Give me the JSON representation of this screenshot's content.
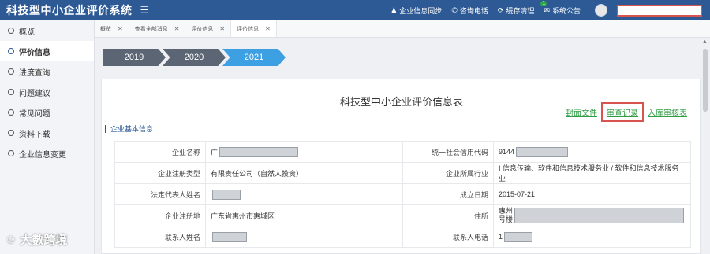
{
  "app": {
    "title": "科技型中小企业评价系统",
    "menu_icon": "hamburger-icon"
  },
  "topbar": {
    "actions": [
      {
        "icon": "user-icon",
        "label": "企业信息同步"
      },
      {
        "icon": "phone-icon",
        "label": "咨询电话"
      },
      {
        "icon": "cache-icon",
        "label": "缓存清理"
      },
      {
        "icon": "notice-icon",
        "label": "系统公告",
        "badge": "1"
      }
    ]
  },
  "sidebar": {
    "items": [
      {
        "label": "概览"
      },
      {
        "label": "评价信息"
      },
      {
        "label": "进度查询"
      },
      {
        "label": "问题建议"
      },
      {
        "label": "常见问题"
      },
      {
        "label": "资料下载"
      },
      {
        "label": "企业信息变更"
      }
    ]
  },
  "tabs": [
    {
      "label": "概览"
    },
    {
      "label": "查看全部消息"
    },
    {
      "label": "评价信息"
    },
    {
      "label": "评价信息"
    }
  ],
  "years": [
    "2019",
    "2020",
    "2021"
  ],
  "form": {
    "title": "科技型中小企业评价信息表",
    "links": [
      "封面文件",
      "审查记录",
      "入库审核表"
    ],
    "section": "企业基本信息",
    "rows": [
      {
        "l1": "企业名称",
        "v1": "广",
        "l2": "统一社会信用代码",
        "v2": "9144"
      },
      {
        "l1": "企业注册类型",
        "v1": "有限责任公司（自然人投资）",
        "l2": "企业所属行业",
        "v2": "I 信息传输、软件和信息技术服务业 / 软件和信息技术服务业"
      },
      {
        "l1": "法定代表人姓名",
        "v1": "",
        "l2": "成立日期",
        "v2": "2015-07-21"
      },
      {
        "l1": "企业注册地",
        "v1": "广东省惠州市惠城区",
        "l2": "住所",
        "v2": "惠州"
      },
      {
        "l1": "联系人姓名",
        "v1": "",
        "l2": "联系人电话",
        "v2": "1"
      }
    ],
    "address_line2": "号楼"
  },
  "watermark": "大數跨境"
}
